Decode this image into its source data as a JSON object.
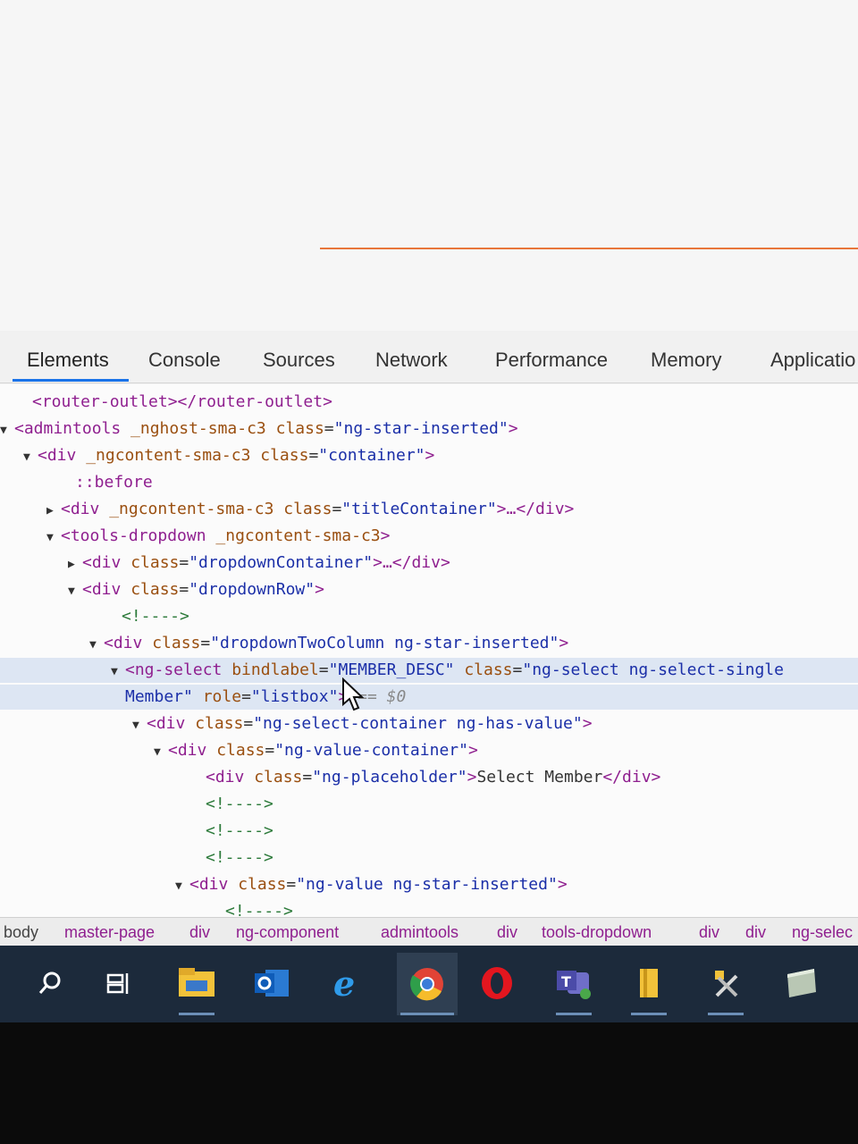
{
  "devtools": {
    "tabs": [
      "Elements",
      "Console",
      "Sources",
      "Network",
      "Performance",
      "Memory",
      "Applicatio"
    ],
    "active_tab": "Elements"
  },
  "tree": [
    {
      "indent": 20,
      "tri": "",
      "parts": [
        [
          "tag",
          "<router-outlet></router-outlet>"
        ]
      ]
    },
    {
      "indent": 0,
      "tri": "▼",
      "parts": [
        [
          "tag",
          "<admintools "
        ],
        [
          "attr",
          "_nghost-sma-c3 class"
        ],
        [
          "txt",
          "="
        ],
        [
          "val",
          "\"ng-star-inserted\""
        ],
        [
          "tag",
          ">"
        ]
      ]
    },
    {
      "indent": 26,
      "tri": "▼",
      "parts": [
        [
          "tag",
          "<div "
        ],
        [
          "attr",
          "_ngcontent-sma-c3 class"
        ],
        [
          "txt",
          "="
        ],
        [
          "val",
          "\"container\""
        ],
        [
          "tag",
          ">"
        ]
      ]
    },
    {
      "indent": 68,
      "tri": "",
      "parts": [
        [
          "pseudo",
          "::before"
        ]
      ]
    },
    {
      "indent": 52,
      "tri": "▶",
      "parts": [
        [
          "tag",
          "<div "
        ],
        [
          "attr",
          "_ngcontent-sma-c3 class"
        ],
        [
          "txt",
          "="
        ],
        [
          "val",
          "\"titleContainer\""
        ],
        [
          "tag",
          ">…</div>"
        ]
      ]
    },
    {
      "indent": 52,
      "tri": "▼",
      "parts": [
        [
          "tag",
          "<tools-dropdown "
        ],
        [
          "attr",
          "_ngcontent-sma-c3"
        ],
        [
          "tag",
          ">"
        ]
      ]
    },
    {
      "indent": 76,
      "tri": "▶",
      "parts": [
        [
          "tag",
          "<div "
        ],
        [
          "attr",
          "class"
        ],
        [
          "txt",
          "="
        ],
        [
          "val",
          "\"dropdownContainer\""
        ],
        [
          "tag",
          ">…</div>"
        ]
      ]
    },
    {
      "indent": 76,
      "tri": "▼",
      "parts": [
        [
          "tag",
          "<div "
        ],
        [
          "attr",
          "class"
        ],
        [
          "txt",
          "="
        ],
        [
          "val",
          "\"dropdownRow\""
        ],
        [
          "tag",
          ">"
        ]
      ]
    },
    {
      "indent": 120,
      "tri": "",
      "parts": [
        [
          "comment",
          "<!---->"
        ]
      ]
    },
    {
      "indent": 100,
      "tri": "▼",
      "parts": [
        [
          "tag",
          "<div "
        ],
        [
          "attr",
          "class"
        ],
        [
          "txt",
          "="
        ],
        [
          "val",
          "\"dropdownTwoColumn ng-star-inserted\""
        ],
        [
          "tag",
          ">"
        ]
      ]
    },
    {
      "indent": 124,
      "tri": "▼",
      "sel": true,
      "parts": [
        [
          "tag",
          "<ng-select "
        ],
        [
          "attr",
          "bindlabel"
        ],
        [
          "txt",
          "="
        ],
        [
          "val",
          "\"MEMBER_DESC\" "
        ],
        [
          "attr",
          "class"
        ],
        [
          "txt",
          "="
        ],
        [
          "val",
          "\"ng-select ng-select-single"
        ]
      ]
    },
    {
      "indent": 124,
      "tri": "",
      "sel": true,
      "parts": [
        [
          "val",
          "Member\" "
        ],
        [
          "attr",
          "role"
        ],
        [
          "txt",
          "="
        ],
        [
          "val",
          "\"listbox\""
        ],
        [
          "tag",
          ">"
        ],
        [
          "dollar",
          " == $0"
        ]
      ]
    },
    {
      "indent": 148,
      "tri": "▼",
      "parts": [
        [
          "tag",
          "<div "
        ],
        [
          "attr",
          "class"
        ],
        [
          "txt",
          "="
        ],
        [
          "val",
          "\"ng-select-container ng-has-value\""
        ],
        [
          "tag",
          ">"
        ]
      ]
    },
    {
      "indent": 172,
      "tri": "▼",
      "parts": [
        [
          "tag",
          "<div "
        ],
        [
          "attr",
          "class"
        ],
        [
          "txt",
          "="
        ],
        [
          "val",
          "\"ng-value-container\""
        ],
        [
          "tag",
          ">"
        ]
      ]
    },
    {
      "indent": 214,
      "tri": "",
      "parts": [
        [
          "tag",
          "<div "
        ],
        [
          "attr",
          "class"
        ],
        [
          "txt",
          "="
        ],
        [
          "val",
          "\"ng-placeholder\""
        ],
        [
          "tag",
          ">"
        ],
        [
          "txt",
          "Select Member"
        ],
        [
          "tag",
          "</div>"
        ]
      ]
    },
    {
      "indent": 214,
      "tri": "",
      "parts": [
        [
          "comment",
          "<!---->"
        ]
      ]
    },
    {
      "indent": 214,
      "tri": "",
      "parts": [
        [
          "comment",
          "<!---->"
        ]
      ]
    },
    {
      "indent": 214,
      "tri": "",
      "parts": [
        [
          "comment",
          "<!---->"
        ]
      ]
    },
    {
      "indent": 196,
      "tri": "▼",
      "parts": [
        [
          "tag",
          "<div "
        ],
        [
          "attr",
          "class"
        ],
        [
          "txt",
          "="
        ],
        [
          "val",
          "\"ng-value ng-star-inserted\""
        ],
        [
          "tag",
          ">"
        ]
      ]
    },
    {
      "indent": 236,
      "tri": "",
      "parts": [
        [
          "comment",
          "<!---->"
        ]
      ]
    }
  ],
  "breadcrumbs": [
    "body",
    "master-page",
    "div",
    "ng-component",
    "admintools",
    "div",
    "tools-dropdown",
    "div",
    "div",
    "ng-selec"
  ],
  "taskbar": [
    "search-icon",
    "task-view-icon",
    "file-explorer-icon",
    "outlook-icon",
    "internet-explorer-icon",
    "chrome-icon",
    "opera-icon",
    "teams-icon",
    "sticky-notes-icon",
    "tools-icon",
    "notes-icon"
  ]
}
